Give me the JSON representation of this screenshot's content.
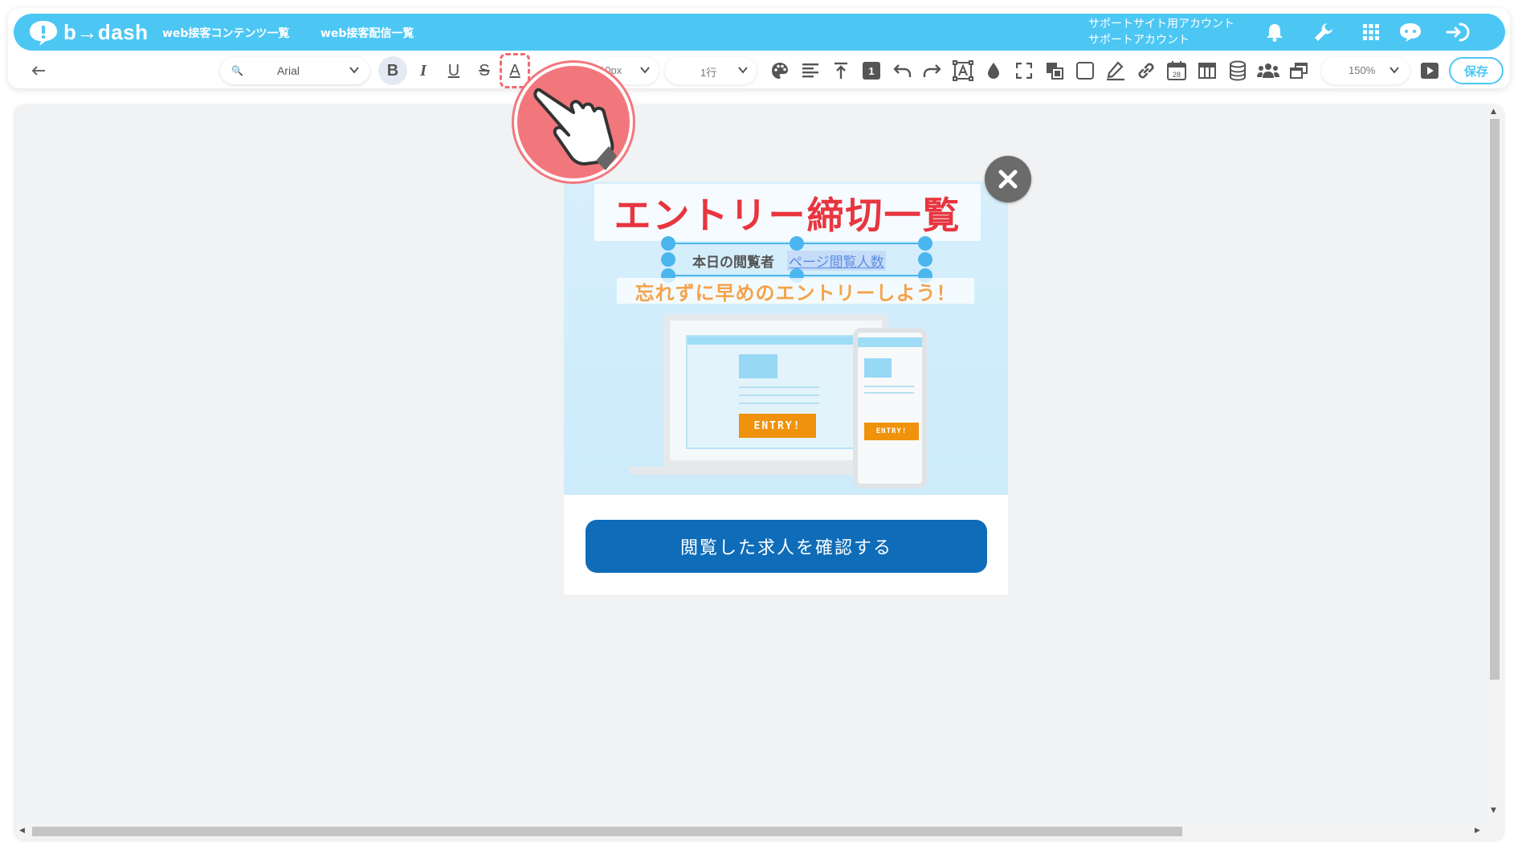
{
  "app": {
    "logo_text": "b→dash",
    "nav": [
      "web接客コンテンツ一覧",
      "web接客配信一覧"
    ],
    "account_line1": "サポートサイト用アカウント",
    "account_line2": "サポートアカウント",
    "top_icons": [
      "bell-icon",
      "wrench-icon",
      "grid-icon",
      "chat-icon",
      "logout-icon"
    ]
  },
  "toolbar": {
    "font_family": "Arial",
    "font_size": "10px",
    "line_height": "1行",
    "zoom": "150%",
    "save_label": "保存",
    "format_buttons": {
      "bold": "B",
      "italic": "I",
      "underline": "U",
      "strike": "S",
      "color": "A"
    },
    "block_number": "1",
    "calendar_day": "28"
  },
  "popup": {
    "title": "エントリー締切一覧",
    "viewer_label": "本日の閲覧者",
    "viewer_count": "ページ閲覧人数",
    "motto": "忘れずに早めのエントリーしよう！",
    "entry_label": "ENTRY!",
    "cta_label": "閲覧した求人を確認する"
  },
  "colors": {
    "brand": "#4cc7f4",
    "title_red": "#e8353f",
    "motto_orange": "#f6a24a",
    "cta_blue": "#0f6cb8",
    "selection_blue": "#4bb6ee",
    "hand_badge": "#f2777d"
  }
}
